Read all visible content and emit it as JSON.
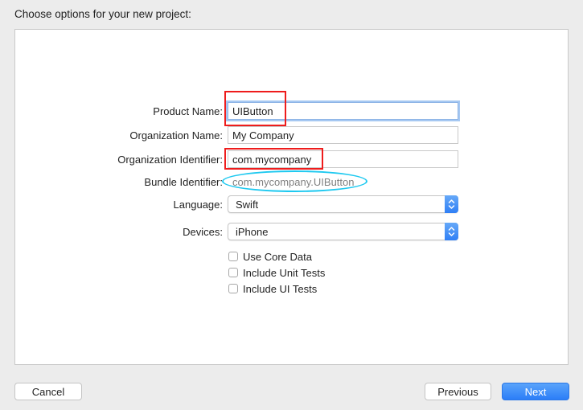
{
  "header": {
    "title": "Choose options for your new project:"
  },
  "form": {
    "product_name": {
      "label": "Product Name:",
      "value": "UIButton"
    },
    "organization_name": {
      "label": "Organization Name:",
      "value": "My Company"
    },
    "organization_identifier": {
      "label": "Organization Identifier:",
      "value": "com.mycompany"
    },
    "bundle_identifier": {
      "label": "Bundle Identifier:",
      "value": "com.mycompany.UIButton"
    },
    "language": {
      "label": "Language:",
      "value": "Swift"
    },
    "devices": {
      "label": "Devices:",
      "value": "iPhone"
    },
    "checkboxes": [
      {
        "label": "Use Core Data",
        "checked": false
      },
      {
        "label": "Include Unit Tests",
        "checked": false
      },
      {
        "label": "Include UI Tests",
        "checked": false
      }
    ]
  },
  "footer": {
    "cancel_label": "Cancel",
    "previous_label": "Previous",
    "next_label": "Next"
  },
  "colors": {
    "annotation_red": "#ee1c1c",
    "annotation_cyan": "#1ec9f0",
    "accent_blue": "#2b7df7"
  }
}
